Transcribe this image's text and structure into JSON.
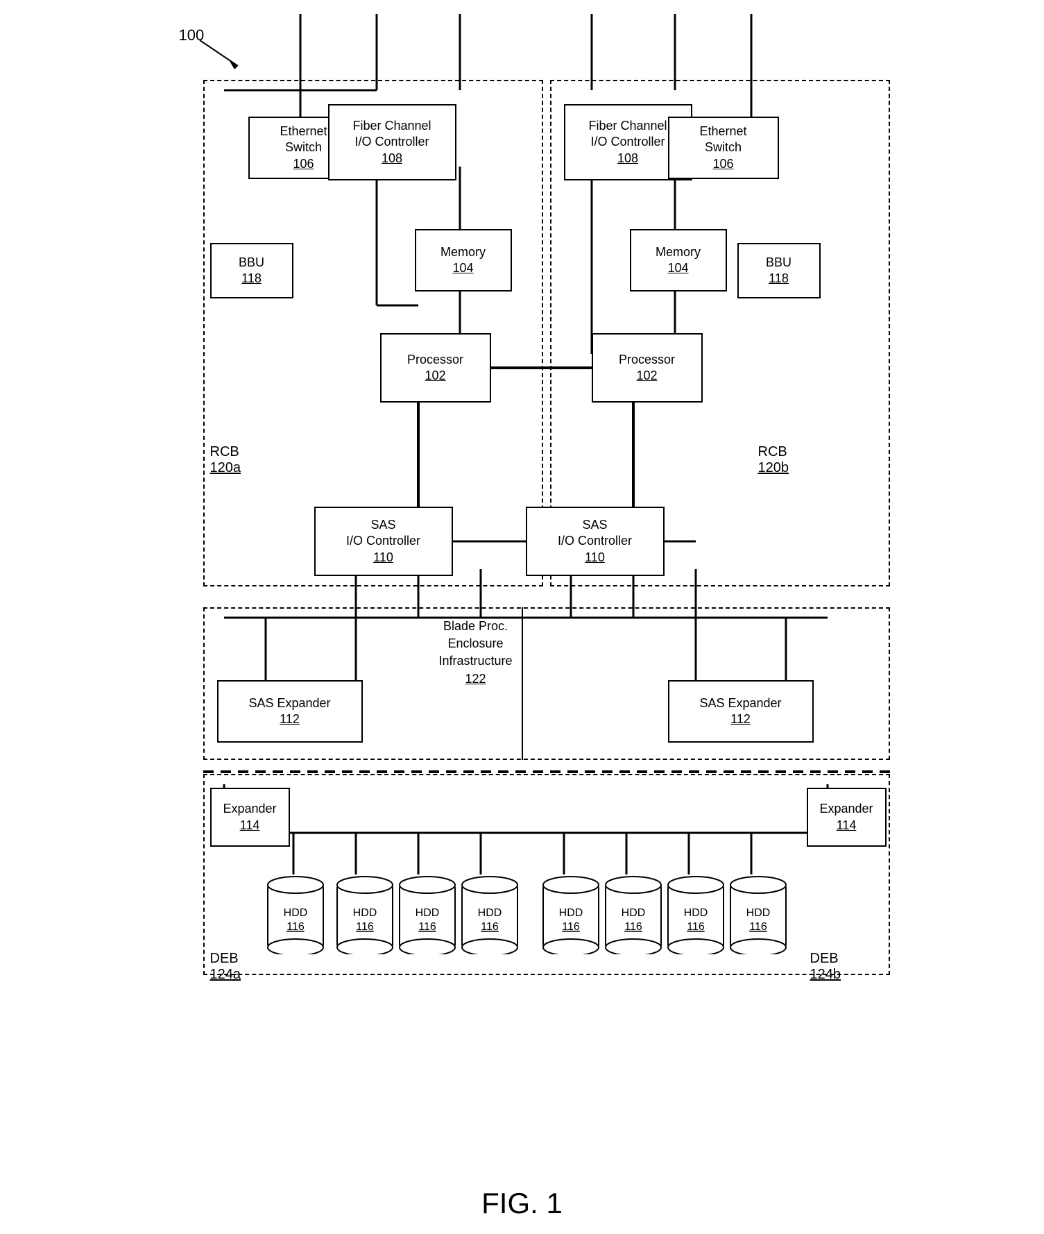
{
  "diagram": {
    "ref": "100",
    "fig_label": "FIG. 1",
    "components": {
      "ethernet_switch": {
        "label": "Ethernet\nSwitch",
        "ref": "106"
      },
      "fiber_channel_left": {
        "label": "Fiber Channel\nI/O Controller",
        "ref": "108"
      },
      "fiber_channel_right": {
        "label": "Fiber Channel\nI/O Controller",
        "ref": "108"
      },
      "ethernet_switch_right": {
        "label": "Ethernet\nSwitch",
        "ref": "106"
      },
      "memory_left": {
        "label": "Memory",
        "ref": "104"
      },
      "memory_right": {
        "label": "Memory",
        "ref": "104"
      },
      "processor_left": {
        "label": "Processor",
        "ref": "102"
      },
      "processor_right": {
        "label": "Processor",
        "ref": "102"
      },
      "bbu_left": {
        "label": "BBU",
        "ref": "118"
      },
      "bbu_right": {
        "label": "BBU",
        "ref": "118"
      },
      "sas_io_left": {
        "label": "SAS\nI/O Controller",
        "ref": "110"
      },
      "sas_io_right": {
        "label": "SAS\nI/O Controller",
        "ref": "110"
      },
      "sas_expander_left": {
        "label": "SAS Expander",
        "ref": "112"
      },
      "sas_expander_right": {
        "label": "SAS Expander",
        "ref": "112"
      },
      "expander_left": {
        "label": "Expander",
        "ref": "114"
      },
      "expander_right": {
        "label": "Expander",
        "ref": "114"
      },
      "rcb_left": {
        "label": "RCB",
        "ref": "120a"
      },
      "rcb_right": {
        "label": "RCB",
        "ref": "120b"
      },
      "deb_left": {
        "label": "DEB",
        "ref": "124a"
      },
      "deb_right": {
        "label": "DEB",
        "ref": "124b"
      },
      "blade_proc": {
        "label": "Blade Proc.\nEnclosure\nInfrastructure",
        "ref": "122"
      },
      "hdd": {
        "label": "HDD",
        "ref": "116"
      }
    }
  }
}
